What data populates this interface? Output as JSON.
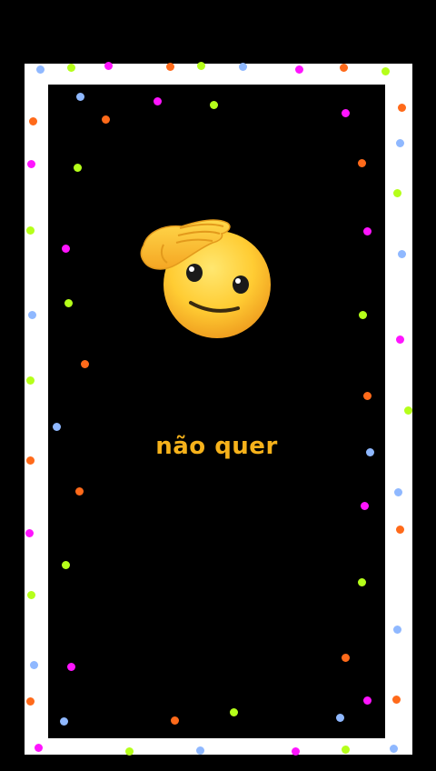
{
  "caption": "não quer",
  "emoji": "saluting-face-icon",
  "colors": {
    "background": "#000000",
    "frame": "#ffffff",
    "caption": "#f6b21b",
    "confetti": [
      "#ff6a1a",
      "#ff14ff",
      "#b5ff1a",
      "#8fb8ff"
    ]
  }
}
